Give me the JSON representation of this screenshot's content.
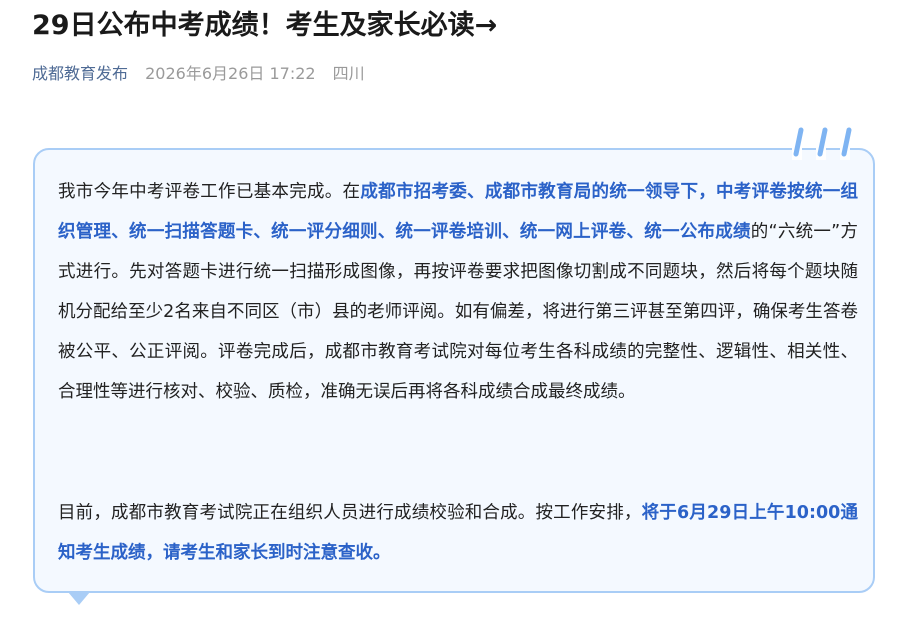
{
  "article": {
    "title": "29日公布中考成绩！考生及家长必读→",
    "account": "成都教育发布",
    "date": "2026年6月26日 17:22",
    "location": "四川"
  },
  "content": {
    "p1": {
      "a": "我市今年中考评卷工作已基本完成。在",
      "b": "成都市招考委、成都市教育局的统一领导下，中考评卷按统一组织管理、统一扫描答题卡、统一评分细则、统一评卷培训、统一网上评卷、统一公布成绩",
      "c": "的“六统一”方式进行。先对答题卡进行统一扫描形成图像，再按评卷要求把图像切割成不同题块，然后将每个题块随机分配给至少2名来自不同区（市）县的老师评阅。如有偏差，将进行第三评甚至第四评，确保考生答卷被公平、公正评阅。评卷完成后，成都市教育考试院对每位考生各科成绩的完整性、逻辑性、相关性、合理性等进行核对、校验、质检，准确无误后再将各科成绩合成最终成绩。"
    },
    "p2": {
      "a": "目前，成都市教育考试院正在组织人员进行成绩校验和合成。按工作安排，",
      "b": "将于6月29日上午10:00通知考生成绩，请考生和家长到时注意查收。"
    }
  },
  "colors": {
    "accent": "#2b62c8",
    "card_border": "#a9cdf6",
    "card_bg": "#f4f9ff",
    "account": "#4f6b95"
  }
}
